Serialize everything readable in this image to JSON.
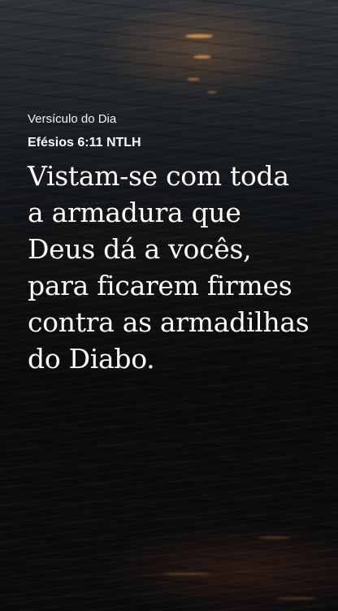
{
  "votd": {
    "label": "Versículo do Dia",
    "reference": "Efésios 6:11 NTLH",
    "text": "Vistam-se com toda a armadura que Deus dá a vocês, para ficarem firmes contra as armadilhas do Diabo."
  }
}
